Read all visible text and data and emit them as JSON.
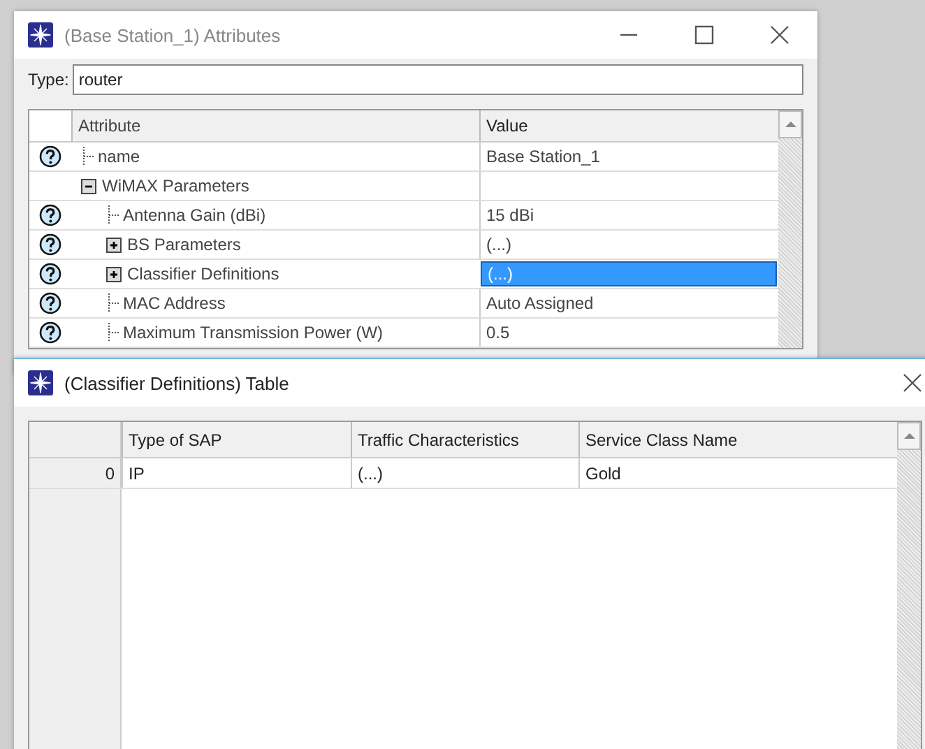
{
  "attributes_window": {
    "title": "(Base Station_1) Attributes",
    "type": {
      "label": "Type:",
      "value": "router"
    },
    "columns": [
      "Attribute",
      "Value"
    ],
    "rows": [
      {
        "label": "name",
        "value": "Base Station_1",
        "help": true,
        "selected": false
      },
      {
        "label": "WiMAX Parameters",
        "help": false,
        "selected": false,
        "expanded": true,
        "children": [
          {
            "label": "Antenna Gain (dBi)",
            "value": "15 dBi",
            "help": true,
            "selected": false
          },
          {
            "label": "BS Parameters",
            "value": "(...)",
            "help": true,
            "selected": false,
            "expanded": false
          },
          {
            "label": "Classifier Definitions",
            "value": "(...)",
            "help": true,
            "selected": true,
            "expanded": false
          },
          {
            "label": "MAC Address",
            "value": "Auto Assigned",
            "help": true,
            "selected": false
          },
          {
            "label": "Maximum Transmission Power (W)",
            "value": "0.5",
            "help": true,
            "selected": false
          }
        ]
      }
    ]
  },
  "table_window": {
    "title": "(Classifier Definitions) Table",
    "columns": [
      "Type of SAP",
      "Traffic Characteristics",
      "Service Class Name"
    ],
    "rows": [
      {
        "index": "0",
        "cells": [
          "IP",
          "(...)",
          "Gold"
        ]
      }
    ]
  }
}
